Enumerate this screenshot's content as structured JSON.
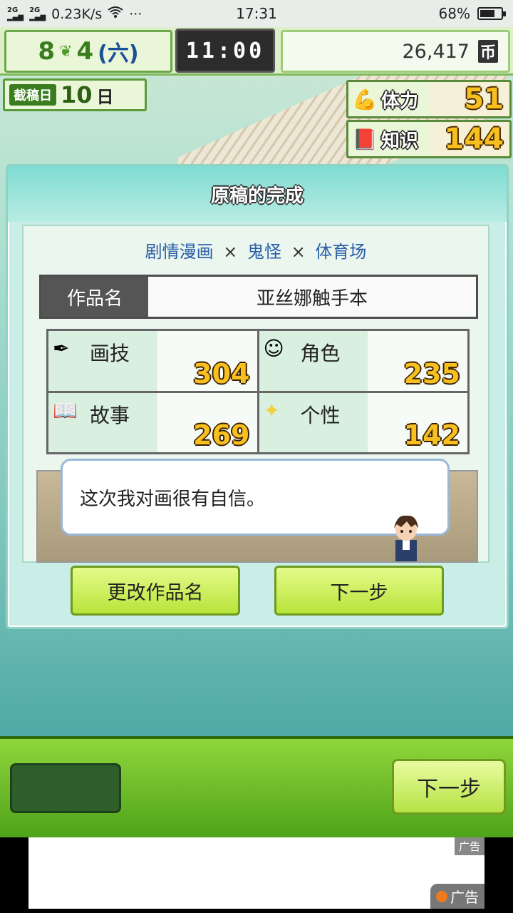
{
  "status_bar": {
    "network1": "2G",
    "network2": "2G",
    "speed": "0.23K/s",
    "more": "···",
    "time": "17:31",
    "battery": "68%",
    "battery_level": 0.68
  },
  "hud": {
    "month": "8",
    "day": "4",
    "weekday": "(六)",
    "clock": "11:00",
    "money": "26,417",
    "money_unit": "币",
    "deadline_label": "截稿日",
    "deadline_days": "10",
    "deadline_unit": "日",
    "stamina_label": "体力",
    "stamina_value": "51",
    "knowledge_label": "知识",
    "knowledge_value": "144"
  },
  "dialog": {
    "title": "原稿的完成",
    "genre1": "剧情漫画",
    "genre2": "鬼怪",
    "genre3": "体育场",
    "sep": "×",
    "work_name_label": "作品名",
    "work_name": "亚丝娜触手本",
    "stats": [
      {
        "name": "画技",
        "value": "304",
        "icon": "pen-icon"
      },
      {
        "name": "角色",
        "value": "235",
        "icon": "character-icon"
      },
      {
        "name": "故事",
        "value": "269",
        "icon": "book-icon"
      },
      {
        "name": "个性",
        "value": "142",
        "icon": "sparkle-icon"
      }
    ],
    "comment": "这次我对画很有自信。",
    "rename_button": "更改作品名",
    "next_button": "下一步"
  },
  "bottom": {
    "next_button": "下一步"
  },
  "ad": {
    "tag": "广告",
    "bottom_label": "广告"
  }
}
